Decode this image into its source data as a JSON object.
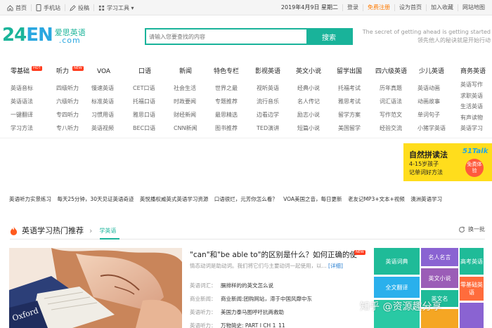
{
  "topbar": {
    "left": [
      {
        "label": "首页",
        "icon": "home-icon"
      },
      {
        "label": "手机站",
        "icon": "phone-icon"
      },
      {
        "label": "投稿",
        "icon": "pen-icon"
      },
      {
        "label": "学习工具 ▾",
        "icon": "grid-icon"
      }
    ],
    "date": "2019年4月9日 星期二",
    "login": "登录",
    "register": "免费注册",
    "set_home": "设为首页",
    "favorite": "加入收藏",
    "map": "网站地图"
  },
  "logo": {
    "digits": "24",
    "letters": "EN",
    "cn": "爱思英语",
    "com": ".com"
  },
  "search": {
    "placeholder": "请输入您要查找的内容",
    "button": "搜索"
  },
  "slogan": {
    "en": "The secret of getting ahead is getting started",
    "cn": "领先他人的秘诀就是开始行动"
  },
  "categories": [
    {
      "title": "零基础",
      "badge": "HOT",
      "items": [
        "英语音标",
        "英语语法",
        "一键翻译",
        "学习方法"
      ]
    },
    {
      "title": "听力",
      "badge": "NEW",
      "items": [
        "四级听力",
        "六级听力",
        "专四听力",
        "专八听力"
      ]
    },
    {
      "title": "VOA",
      "badge": "",
      "items": [
        "慢速英语",
        "标准英语",
        "习惯用语",
        "英语视频"
      ]
    },
    {
      "title": "口语",
      "badge": "",
      "items": [
        "CET口语",
        "托福口语",
        "雅思口语",
        "BEC口语"
      ]
    },
    {
      "title": "新闻",
      "badge": "",
      "items": [
        "社会生活",
        "时政要闻",
        "财经新闻",
        "CNN新闻"
      ]
    },
    {
      "title": "特色专栏",
      "badge": "",
      "items": [
        "世界之最",
        "专题推荐",
        "最思精选",
        "图书推荐"
      ]
    },
    {
      "title": "影视英语",
      "badge": "",
      "items": [
        "视听英语",
        "流行音乐",
        "边看边学",
        "TED演讲"
      ]
    },
    {
      "title": "英文小说",
      "badge": "",
      "items": [
        "经典小说",
        "名人传记",
        "励志小说",
        "短篇小说"
      ]
    },
    {
      "title": "留学出国",
      "badge": "",
      "items": [
        "托福考试",
        "雅思考试",
        "留学方案",
        "美国留学"
      ]
    },
    {
      "title": "四六级英语",
      "badge": "",
      "items": [
        "历年真题",
        "词汇语法",
        "写作范文",
        "经验交流"
      ]
    },
    {
      "title": "少儿英语",
      "badge": "",
      "items": [
        "英语动画",
        "动画故事",
        "单词句子",
        "小猪学英语"
      ]
    },
    {
      "title": "商务英语",
      "badge": "",
      "items": [
        "英语写作",
        "求职英语",
        "生活英语",
        "有声读物",
        "英语学习"
      ]
    }
  ],
  "banner": {
    "title": "自然拼读法",
    "line1": "4-15岁孩子",
    "line2": "记单词好方法",
    "brand": "51Talk",
    "cta": "免费体验"
  },
  "news_strip": [
    "英语听力实景练习",
    "每天25分钟，30天见证英语奇迹",
    "英悦播权威英式英语学习资源",
    "口语很烂，元芳你怎么看？",
    "VOA美国之音，每日更新",
    "老友记MP3+文本+视频",
    "澳洲英语学习"
  ],
  "hot": {
    "title": "英语学习热门推荐",
    "tab": "学英语",
    "refresh": "换一批"
  },
  "article": {
    "title": "\"can\"和\"be able to\"的区别是什么？如何正确的使",
    "new_badge": "NEW",
    "desc": "情态动词是助动词。我们将它们与主要动词一起使用，以...",
    "more": "[详细]",
    "rows": [
      {
        "key": "英语词汇：",
        "value": "膈排样的的英文怎么说"
      },
      {
        "key": "商业新闻：",
        "value": "商业新闻:团购网站，滞于中国风靡中东"
      },
      {
        "key": "英语听力：",
        "value": "美国力泰马图呼吁抗两救助"
      },
      {
        "key": "英语听力：",
        "value": "万物简史: PART I CH 1_11"
      }
    ]
  },
  "tiles": [
    "英语词典",
    "名人名言",
    "高考英语",
    "全文翻译",
    "英文小说",
    "零基础英语",
    "英文名",
    "",
    "",
    ""
  ],
  "watermark": "知乎 @资源趣分享"
}
